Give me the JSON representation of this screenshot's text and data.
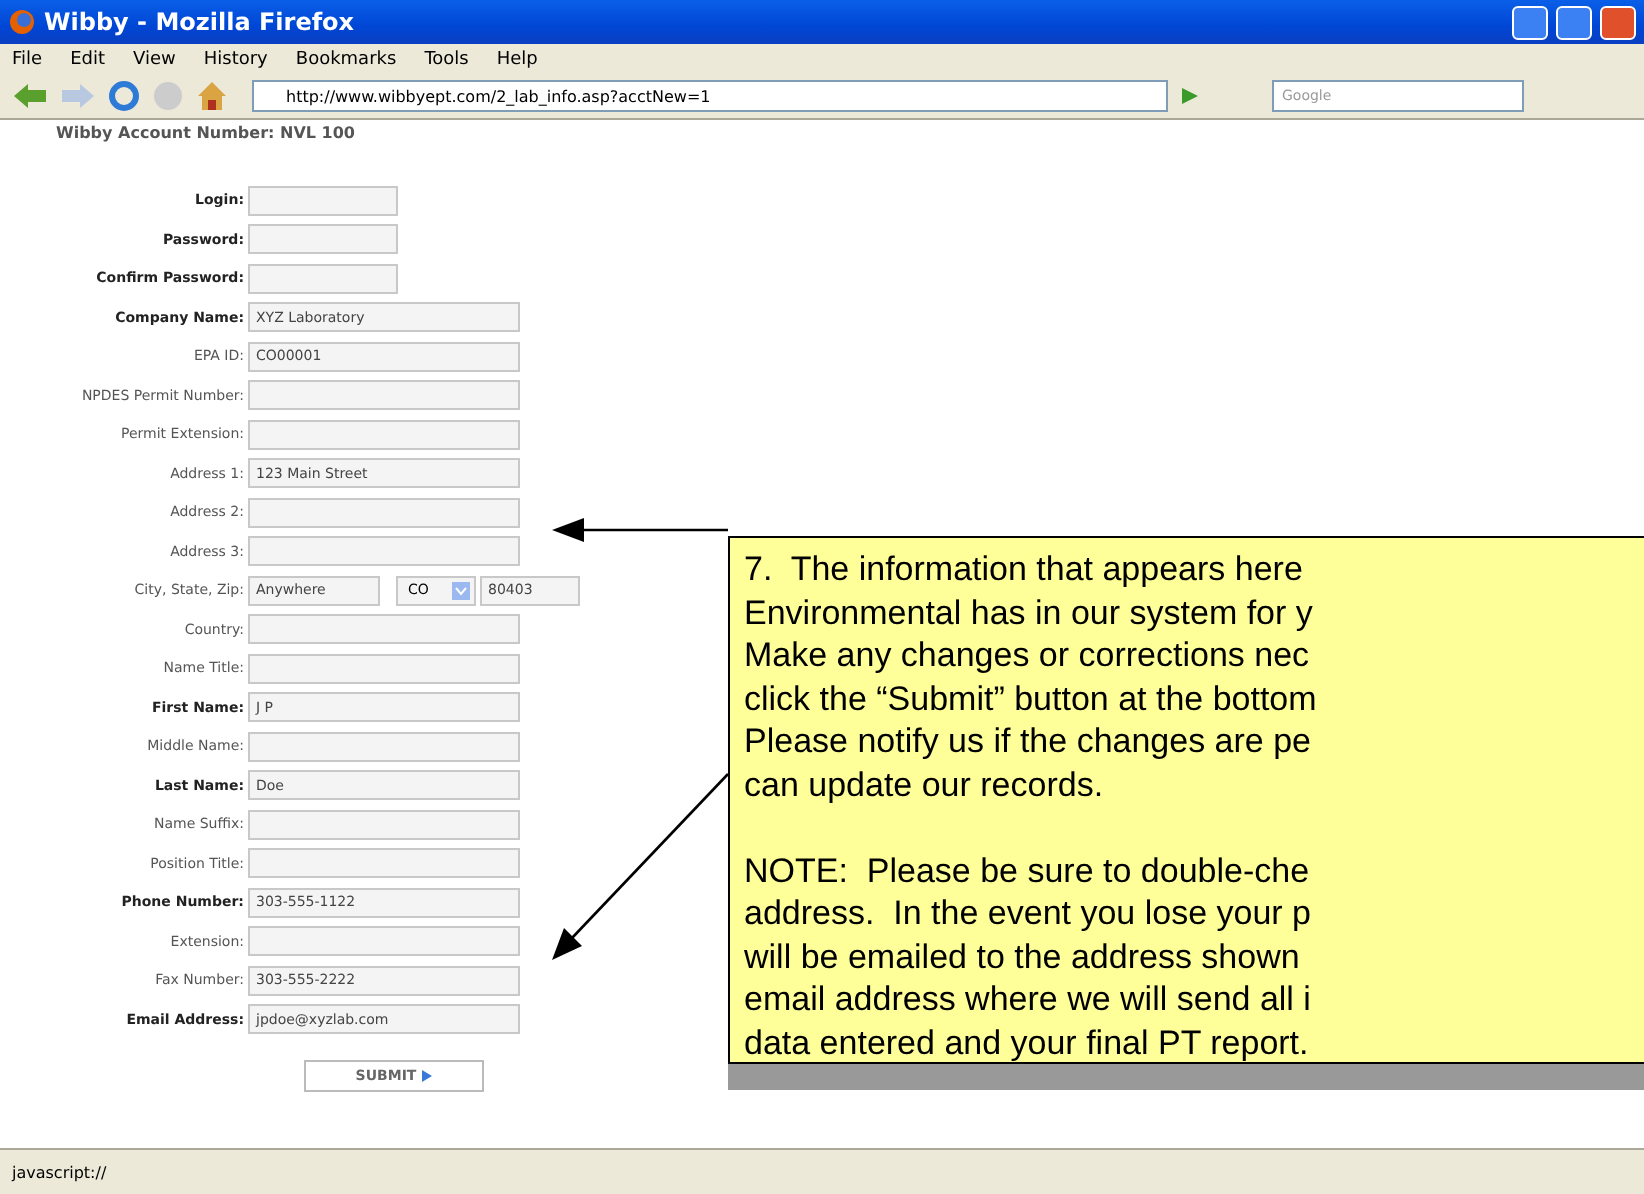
{
  "window": {
    "title": "Wibby - Mozilla Firefox"
  },
  "menu": [
    "File",
    "Edit",
    "View",
    "History",
    "Bookmarks",
    "Tools",
    "Help"
  ],
  "address_bar": {
    "value": "http://www.wibbyept.com/2_lab_info.asp?acctNew=1"
  },
  "search": {
    "placeholder": "Google"
  },
  "account_line": "Wibby Account Number: NVL 100",
  "form": [
    {
      "label": "Login:",
      "bold": true,
      "kind": "short"
    },
    {
      "label": "Password:",
      "bold": true,
      "kind": "short"
    },
    {
      "label": "Confirm Password:",
      "bold": true,
      "kind": "short"
    },
    {
      "label": "Company Name:",
      "bold": true,
      "kind": "long",
      "value": "XYZ Laboratory"
    },
    {
      "label": "EPA ID:",
      "bold": false,
      "kind": "long",
      "value": "CO00001"
    },
    {
      "label": "NPDES Permit Number:",
      "bold": false,
      "kind": "long"
    },
    {
      "label": "Permit Extension:",
      "bold": false,
      "kind": "long"
    },
    {
      "label": "Address 1:",
      "bold": false,
      "kind": "long",
      "value": "123 Main Street"
    },
    {
      "label": "Address 2:",
      "bold": false,
      "kind": "long"
    },
    {
      "label": "Address 3:",
      "bold": false,
      "kind": "long"
    },
    {
      "label": "City, State, Zip:",
      "bold": false,
      "kind": "city",
      "value": "Anywhere",
      "state": "CO",
      "zip": "80403"
    },
    {
      "label": "Country:",
      "bold": false,
      "kind": "long"
    },
    {
      "label": "Name Title:",
      "bold": false,
      "kind": "long"
    },
    {
      "label": "First Name:",
      "bold": true,
      "kind": "long",
      "value": "J P"
    },
    {
      "label": "Middle Name:",
      "bold": false,
      "kind": "long"
    },
    {
      "label": "Last Name:",
      "bold": true,
      "kind": "long",
      "value": "Doe"
    },
    {
      "label": "Name Suffix:",
      "bold": false,
      "kind": "long"
    },
    {
      "label": "Position Title:",
      "bold": false,
      "kind": "long"
    },
    {
      "label": "Phone Number:",
      "bold": true,
      "kind": "long",
      "value": "303-555-1122"
    },
    {
      "label": "Extension:",
      "bold": false,
      "kind": "long"
    },
    {
      "label": "Fax Number:",
      "bold": false,
      "kind": "long",
      "value": "303-555-2222"
    },
    {
      "label": "Email Address:",
      "bold": true,
      "kind": "long",
      "value": "jpdoe@xyzlab.com"
    }
  ],
  "submit": "SUBMIT",
  "callout": {
    "paragraphs": [
      [
        "7.  The information that appears here",
        "Environmental has in our system for y",
        "Make any changes or corrections nec",
        "click the “Submit” button at the bottom",
        "Please notify us if the changes are pe",
        "can update our records."
      ],
      [
        "NOTE:  Please be sure to double-che",
        "address.  In the event you lose your p",
        "will be emailed to the address shown",
        "email address where we will send all i",
        "data entered and your final PT report."
      ]
    ]
  },
  "status_bar": "javascript://"
}
